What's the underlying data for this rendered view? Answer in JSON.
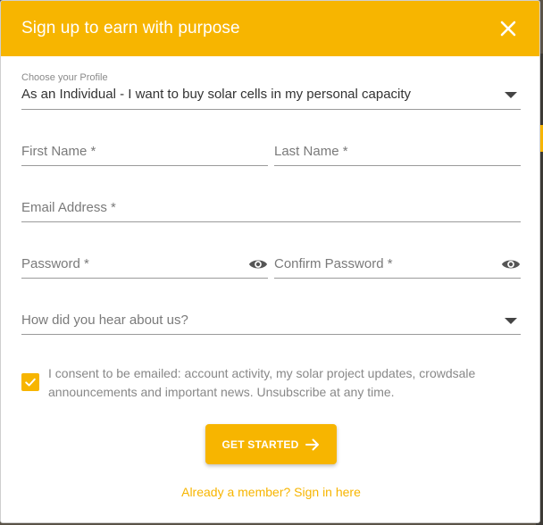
{
  "modal": {
    "title": "Sign up to earn with purpose",
    "close_icon": "close-icon"
  },
  "profile": {
    "label": "Choose your Profile",
    "selected": "As an Individual - I want to buy solar cells in my personal capacity"
  },
  "fields": {
    "first_name": "First Name *",
    "last_name": "Last Name *",
    "email": "Email Address *",
    "password": "Password *",
    "confirm_password": "Confirm Password *",
    "referral": "How did you hear about us?"
  },
  "consent": {
    "checked": true,
    "text": "I consent to be emailed: account activity, my solar project updates, crowdsale announcements and important news. Unsubscribe at any time."
  },
  "cta": {
    "label": "GET STARTED",
    "icon": "arrow-right-icon"
  },
  "signin_link": "Already a member? Sign in here",
  "colors": {
    "accent": "#f7b500",
    "text": "#333333",
    "muted": "#888888"
  }
}
